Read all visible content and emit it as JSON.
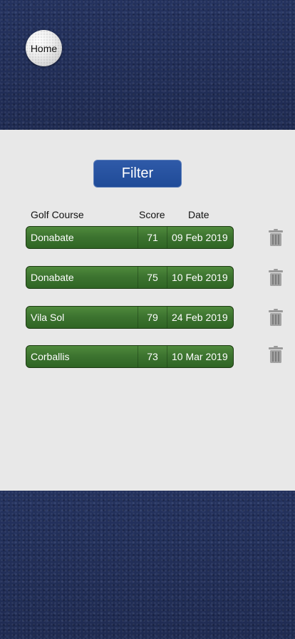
{
  "nav": {
    "home_label": "Home"
  },
  "toolbar": {
    "filter_label": "Filter"
  },
  "table": {
    "headers": {
      "course": "Golf Course",
      "score": "Score",
      "date": "Date"
    },
    "rows": [
      {
        "course": "Donabate",
        "score": "71",
        "date": "09 Feb 2019"
      },
      {
        "course": "Donabate",
        "score": "75",
        "date": "10 Feb 2019"
      },
      {
        "course": "Vila Sol",
        "score": "79",
        "date": "24 Feb 2019"
      },
      {
        "course": "Corballis",
        "score": "73",
        "date": "10 Mar 2019"
      }
    ]
  },
  "icons": {
    "home": "golf-ball-icon",
    "delete": "trash-icon"
  },
  "colors": {
    "background_texture": "#22305a",
    "panel": "#e8e8e8",
    "filter_button": "#2356a3",
    "row_green": "#3d7430",
    "trash_grey": "#9a9a9a"
  }
}
